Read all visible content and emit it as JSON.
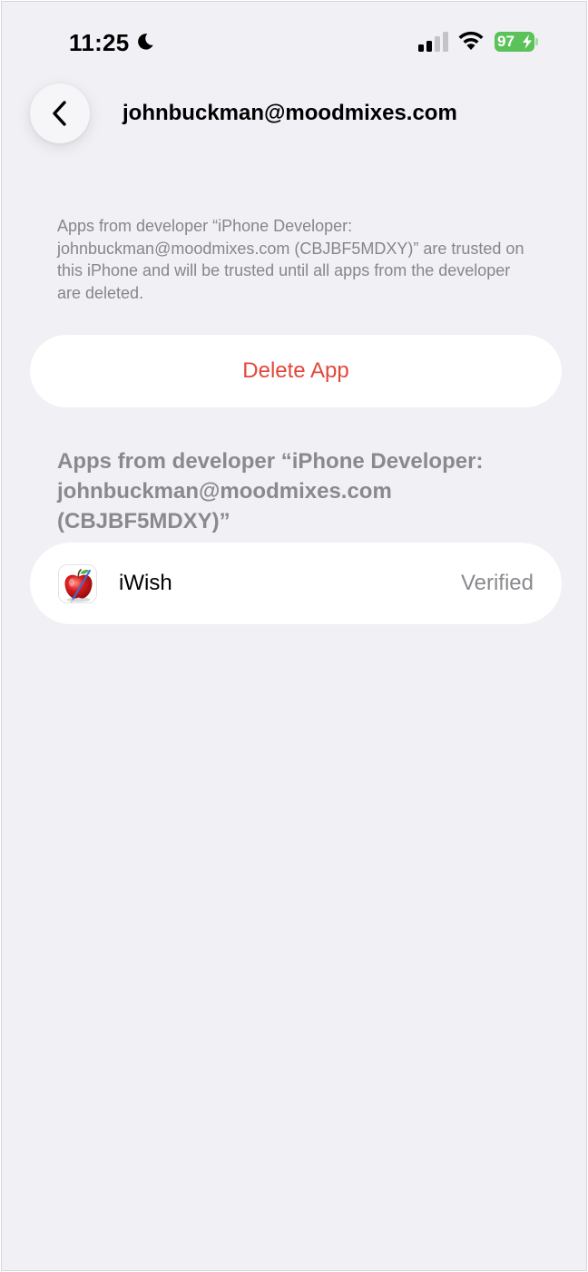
{
  "status_bar": {
    "time": "11:25",
    "battery_level": "97",
    "icons": [
      "moon-icon",
      "signal-icon",
      "wifi-icon",
      "battery-icon",
      "bolt-icon"
    ],
    "battery_color": "#5bc25a"
  },
  "nav": {
    "back_icon": "chevron-left-icon",
    "title": "johnbuckman@moodmixes.com"
  },
  "trust_message": "Apps from developer “iPhone Developer: johnbuckman@moodmixes.com (CBJBF5MDXY)” are trusted on this iPhone and will be trusted until all apps from the developer are deleted.",
  "delete_button": {
    "label": "Delete App",
    "color": "#e2473c"
  },
  "apps_section": {
    "header": "Apps from developer “iPhone Developer: johnbuckman@moodmixes.com (CBJBF5MDXY)”",
    "apps": [
      {
        "name": "iWish",
        "status": "Verified",
        "icon": "apple-app-icon"
      }
    ]
  },
  "colors": {
    "background": "#f0f0f5",
    "card": "#ffffff",
    "secondary_text": "#86868b"
  }
}
